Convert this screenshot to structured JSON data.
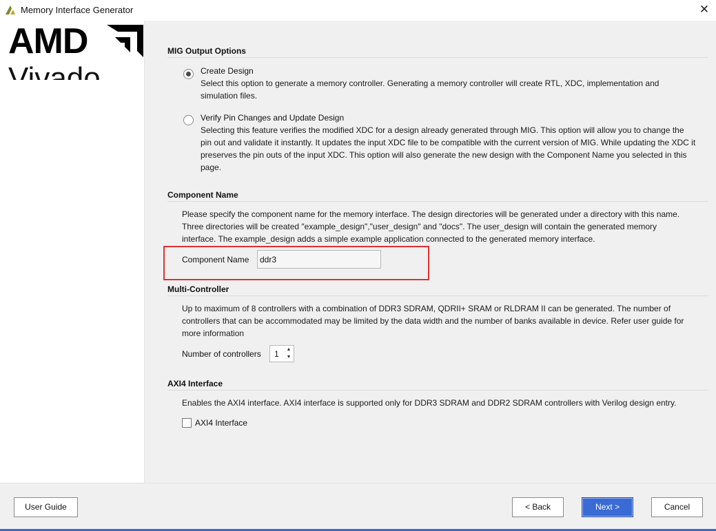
{
  "window": {
    "title": "Memory Interface Generator",
    "close_glyph": "✕"
  },
  "logo": {
    "brand": "AMD",
    "product": "Vivado"
  },
  "mig_output_options": {
    "heading": "MIG Output Options",
    "options": [
      {
        "label": "Create Design",
        "selected": true,
        "description": "Select this option to generate a memory controller. Generating a memory controller will create RTL, XDC, implementation and simulation files."
      },
      {
        "label": "Verify Pin Changes and Update Design",
        "selected": false,
        "description": "Selecting this feature verifies the modified XDC for a design already generated through MIG. This option will allow you to change the pin out and validate it instantly. It updates the input XDC file to be compatible with the current version of MIG. While updating the XDC it preserves the pin outs of the input XDC. This option will also generate the new design with the Component Name you selected in this page."
      }
    ]
  },
  "component_name": {
    "heading": "Component Name",
    "description": "Please specify the component name for the memory interface. The design directories will be generated under a directory with this name. Three directories will be created \"example_design\",\"user_design\" and \"docs\". The user_design will contain the generated memory interface. The example_design adds a simple example application connected to the generated memory interface.",
    "field_label": "Component Name",
    "value": "ddr3"
  },
  "multi_controller": {
    "heading": "Multi-Controller",
    "description": "Up to maximum of 8 controllers with a combination of DDR3 SDRAM, QDRII+ SRAM or RLDRAM II can be generated. The number of controllers that can be accommodated may be limited by the data width and the number of banks available in device. Refer user guide for more information",
    "field_label": "Number of controllers",
    "value": "1"
  },
  "axi4": {
    "heading": "AXI4 Interface",
    "description": "Enables the AXI4 interface. AXI4 interface is supported only for DDR3 SDRAM and DDR2 SDRAM controllers with Verilog design entry.",
    "checkbox_label": "AXI4 Interface",
    "checked": false
  },
  "footer": {
    "user_guide": "User Guide",
    "back": "< Back",
    "next": "Next >",
    "cancel": "Cancel"
  },
  "colors": {
    "accent": "#3a6ad4",
    "highlight_box": "#e03131",
    "panel_bg": "#f0f0f0"
  }
}
